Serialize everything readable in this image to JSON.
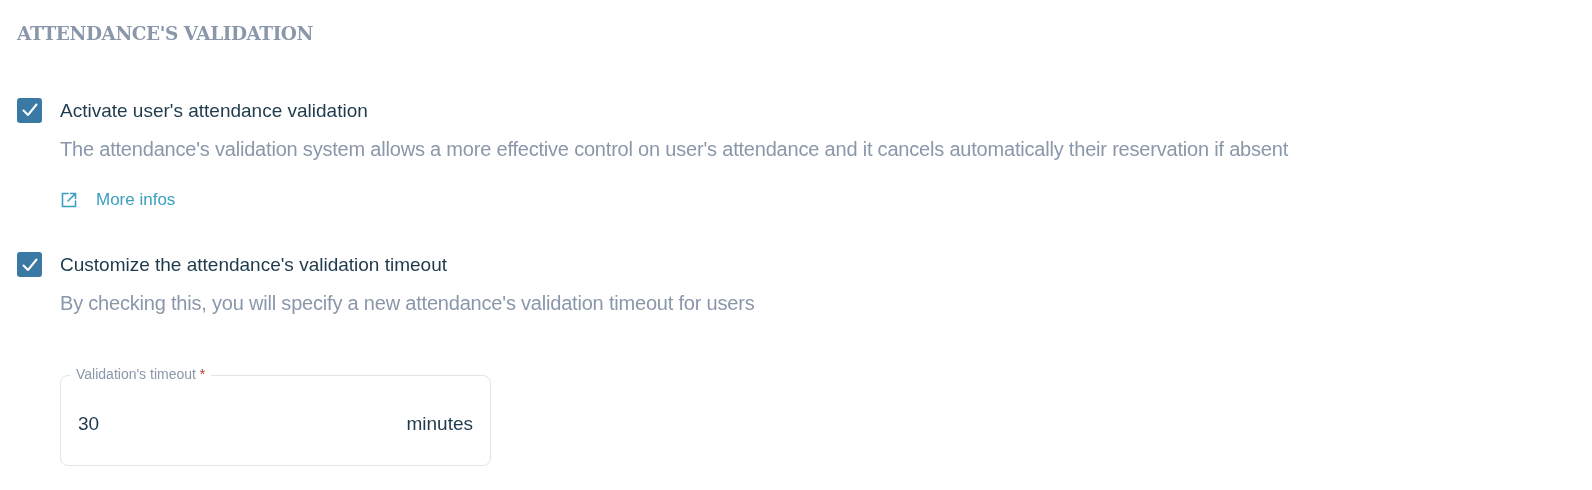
{
  "section_title": "ATTENDANCE'S VALIDATION",
  "options": [
    {
      "label": "Activate user's attendance validation",
      "checked": true,
      "description": "The attendance's validation system allows a more effective control on user's attendance and it cancels automatically their reservation if absent",
      "link": "More infos"
    },
    {
      "label": "Customize the attendance's validation timeout",
      "checked": true,
      "description": "By checking this, you will specify a new attendance's validation timeout for users"
    }
  ],
  "timeout_field": {
    "label": "Validation's timeout",
    "required_mark": "*",
    "value": "30",
    "suffix": "minutes"
  }
}
